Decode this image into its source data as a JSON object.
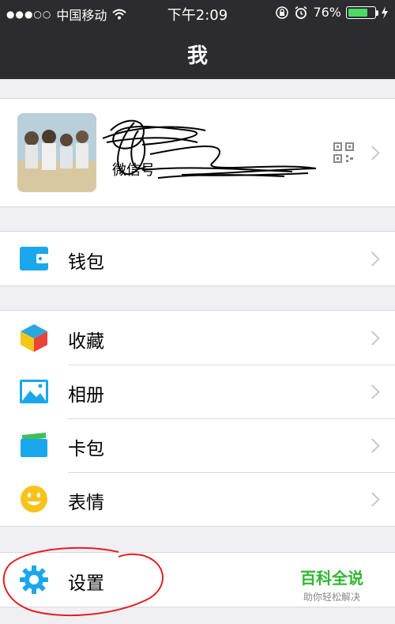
{
  "status_bar": {
    "carrier": "中国移动",
    "time": "下午2:09",
    "battery_percent": "76%",
    "battery_level": 0.76
  },
  "nav": {
    "title": "我"
  },
  "profile": {
    "wechat_id_prefix": "微信号"
  },
  "menu": {
    "wallet": "钱包",
    "favorites": "收藏",
    "album": "相册",
    "cards": "卡包",
    "stickers": "表情",
    "settings": "设置"
  },
  "watermark": {
    "title": "百科全说",
    "subtitle": "助你轻松解决"
  },
  "colors": {
    "nav_bg": "#2b2b30",
    "page_bg": "#efeff4",
    "icon_blue": "#1aa7ec",
    "battery_green": "#4cd964",
    "annotation_red": "#e02020"
  }
}
